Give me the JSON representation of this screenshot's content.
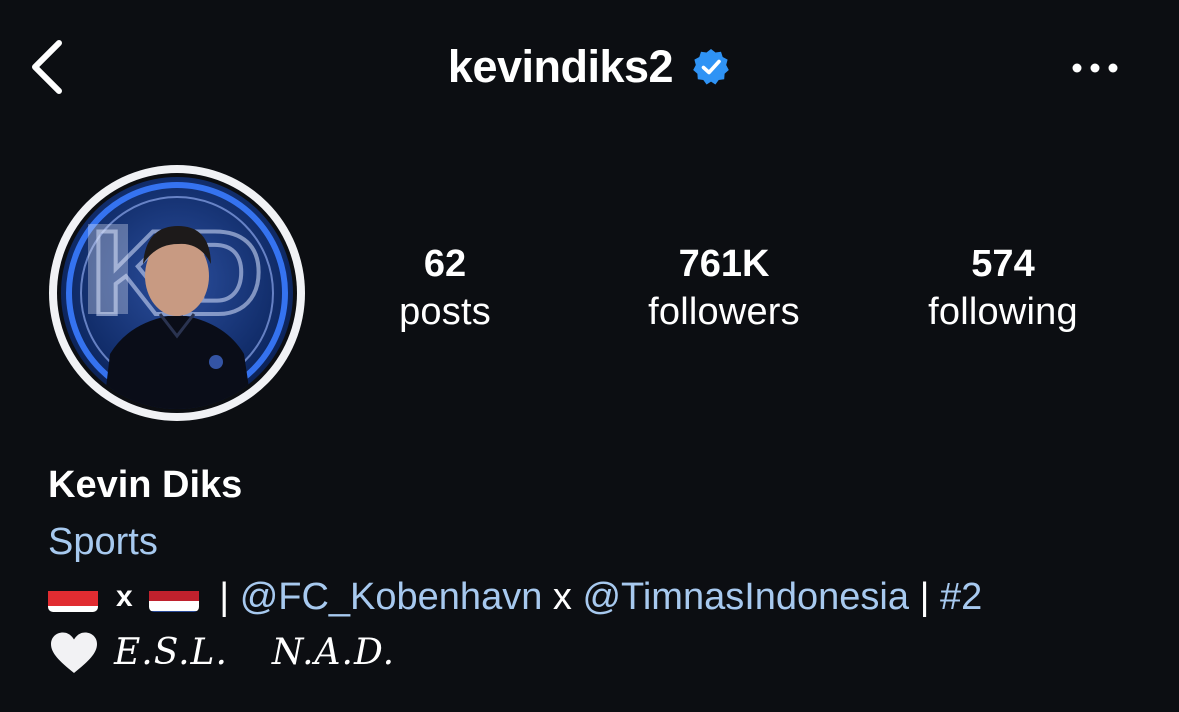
{
  "header": {
    "username": "kevindiks2",
    "back_icon": "chevron-left-icon",
    "verified_icon": "verified-badge-icon",
    "more_icon": "more-horizontal-icon"
  },
  "profile": {
    "avatar_icon": "profile-photo",
    "stats": [
      {
        "value": "62",
        "label": "posts"
      },
      {
        "value": "761K",
        "label": "followers"
      },
      {
        "value": "574",
        "label": "following"
      }
    ]
  },
  "bio": {
    "full_name": "Kevin Diks",
    "category": "Sports",
    "line1": {
      "flag_1": "indonesia-flag-icon",
      "x": "x",
      "flag_2": "netherlands-flag-icon",
      "pipe_1": " | ",
      "mention_1": "@FC_Kobenhavn",
      "x_2": " x ",
      "mention_2": "@TimnasIndonesia",
      "pipe_2": " | ",
      "hashtag": "#2"
    },
    "line2": {
      "heart": "white-heart-icon",
      "text_1": "E.S.L.",
      "text_2": "N.A.D."
    }
  },
  "colors": {
    "background": "#0c0e12",
    "link": "#a7c9ef",
    "verified": "#2f93f5"
  }
}
